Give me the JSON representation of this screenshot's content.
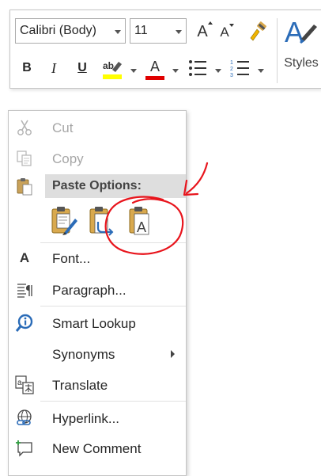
{
  "toolbar": {
    "font_name": "Calibri (Body)",
    "font_size": "11",
    "styles_label": "Styles",
    "bold_label": "B",
    "italic_label": "I",
    "underline_label": "U",
    "grow_font_label": "A",
    "shrink_font_label": "A",
    "font_color_label": "A",
    "styles_glyph": "A",
    "font_color_bar": "#e00000",
    "highlight_bar": "#ffff00",
    "icons": [
      "increase-font-size-icon",
      "decrease-font-size-icon",
      "format-painter-icon",
      "bold-icon",
      "italic-icon",
      "underline-icon",
      "highlight-icon",
      "font-color-icon",
      "bullets-icon",
      "numbering-icon",
      "styles-icon"
    ]
  },
  "menu": {
    "items": [
      {
        "label": "Cut",
        "enabled": false,
        "icon": "scissors-icon"
      },
      {
        "label": "Copy",
        "enabled": false,
        "icon": "copy-icon"
      },
      {
        "label": "Paste Options:",
        "enabled": true,
        "icon": "clipboard-icon"
      },
      {
        "label": "Font...",
        "enabled": true,
        "icon": "font-icon"
      },
      {
        "label": "Paragraph...",
        "enabled": true,
        "icon": "paragraph-icon"
      },
      {
        "label": "Smart Lookup",
        "enabled": true,
        "icon": "smart-lookup-icon"
      },
      {
        "label": "Synonyms",
        "enabled": true,
        "submenu": true
      },
      {
        "label": "Translate",
        "enabled": true,
        "icon": "translate-icon"
      },
      {
        "label": "Hyperlink...",
        "enabled": true,
        "icon": "hyperlink-icon"
      },
      {
        "label": "New Comment",
        "enabled": true,
        "icon": "new-comment-icon"
      }
    ],
    "paste_options": [
      {
        "name": "keep-source-formatting",
        "icon": "paste-keep-source-icon"
      },
      {
        "name": "merge-formatting",
        "icon": "paste-merge-icon"
      },
      {
        "name": "keep-text-only",
        "icon": "paste-text-only-icon",
        "glyph": "A"
      }
    ],
    "font_icon_glyph": "A"
  },
  "annotation": {
    "color": "#e8141c"
  }
}
